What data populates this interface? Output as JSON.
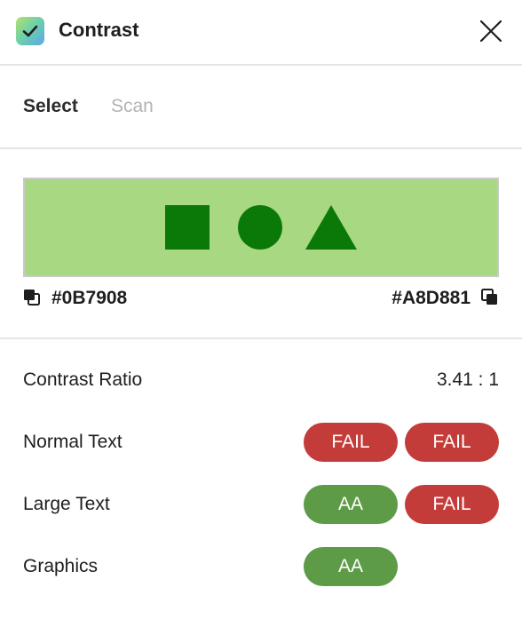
{
  "app": {
    "title": "Contrast",
    "icon": "checkmark-icon",
    "close_icon": "close-icon"
  },
  "tabs": [
    {
      "label": "Select",
      "active": true
    },
    {
      "label": "Scan",
      "active": false
    }
  ],
  "colors": {
    "foreground": "#0B7908",
    "background": "#A8D881",
    "fail": "#C33C3A",
    "pass": "#5D9B46"
  },
  "preview": {
    "shapes": [
      "square",
      "circle",
      "triangle"
    ]
  },
  "labels": {
    "foreground": "#0B7908",
    "background": "#A8D881"
  },
  "results": {
    "ratio_label": "Contrast Ratio",
    "ratio_value": "3.41 : 1",
    "normal_text": {
      "label": "Normal Text",
      "aa": "FAIL",
      "aaa": "FAIL"
    },
    "large_text": {
      "label": "Large Text",
      "aa": "AA",
      "aaa": "FAIL"
    },
    "graphics": {
      "label": "Graphics",
      "aa": "AA"
    }
  }
}
